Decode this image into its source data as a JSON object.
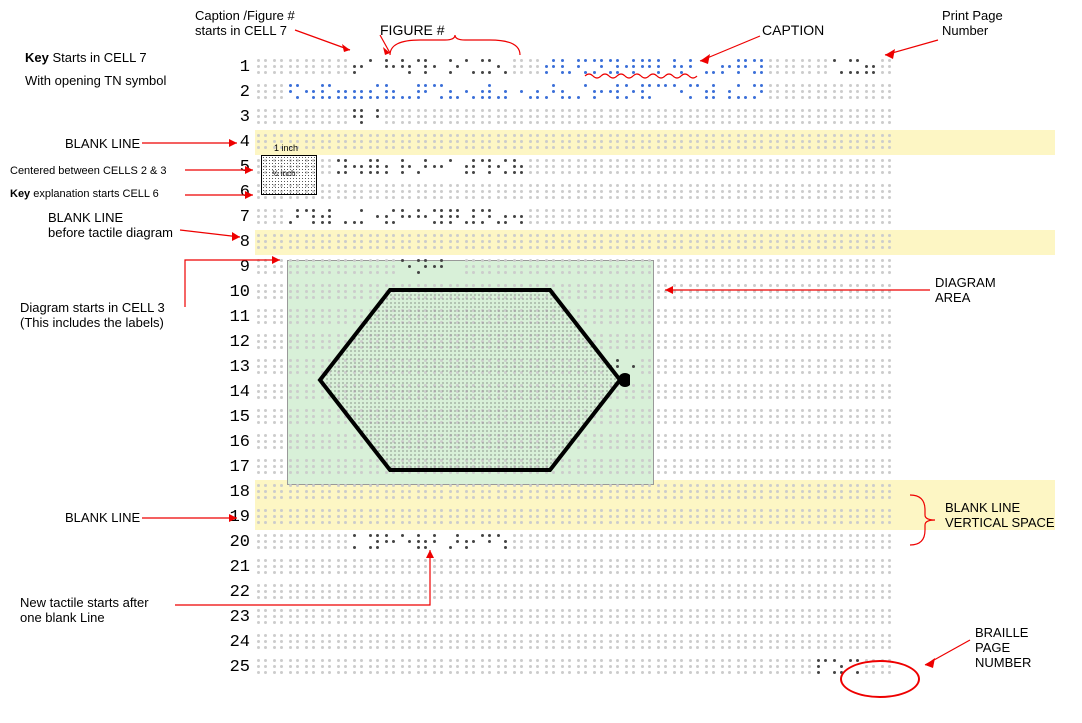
{
  "top_labels": {
    "caption_figure": "Caption /Figure #\nstarts in CELL 7",
    "figure_num": "FIGURE #",
    "caption": "CAPTION",
    "print_page": "Print Page\nNumber"
  },
  "left_labels": {
    "key_starts": "Key Starts in CELL 7",
    "with_tn": "With opening TN symbol",
    "blank_line_1": "BLANK LINE",
    "centered": "Centered between CELLS 2 & 3",
    "key_expl": "Key explanation  starts CELL 6",
    "blank_before": "BLANK LINE\nbefore tactile diagram",
    "diagram_starts": "Diagram starts in CELL 3\n(This includes the labels)",
    "blank_line_2": "BLANK LINE",
    "new_tactile": "New tactile starts after\none blank Line"
  },
  "right_labels": {
    "diagram_area": "DIAGRAM\nAREA",
    "blank_vert": "BLANK LINE\nVERTICAL SPACE",
    "braille_page": "BRAILLE\nPAGE\nNUMBER"
  },
  "dimensions": {
    "one_inch": "1 inch",
    "half_inch": "½ inch"
  },
  "rows": 25,
  "cells_per_row": 40,
  "highlighted_rows_yellow": [
    4,
    8,
    18,
    19
  ],
  "diagram_area_rows": [
    9,
    17
  ],
  "braille_patterns": {
    "row1_dark_start": 7,
    "row1_dark_len": 10,
    "row1_blue_start": 19,
    "row1_blue_len": 14,
    "row1_pp_start": 37,
    "row1_pp_len": 3,
    "row2_blue_start": 3,
    "row2_blue_len": 30,
    "row3_dark_start": 7,
    "row3_dark_len": 2,
    "row5_dark_start": 6,
    "row5_dark_len": 12,
    "row7_dark_start": 3,
    "row7_dark_len": 15,
    "row9_label_start": 10,
    "row9_label_len": 4,
    "row13_label_start": 23,
    "row13_label_len": 2,
    "row20_dark_start": 7,
    "row20_dark_len": 10,
    "row25_bp_start": 36,
    "row25_bp_len": 3
  }
}
